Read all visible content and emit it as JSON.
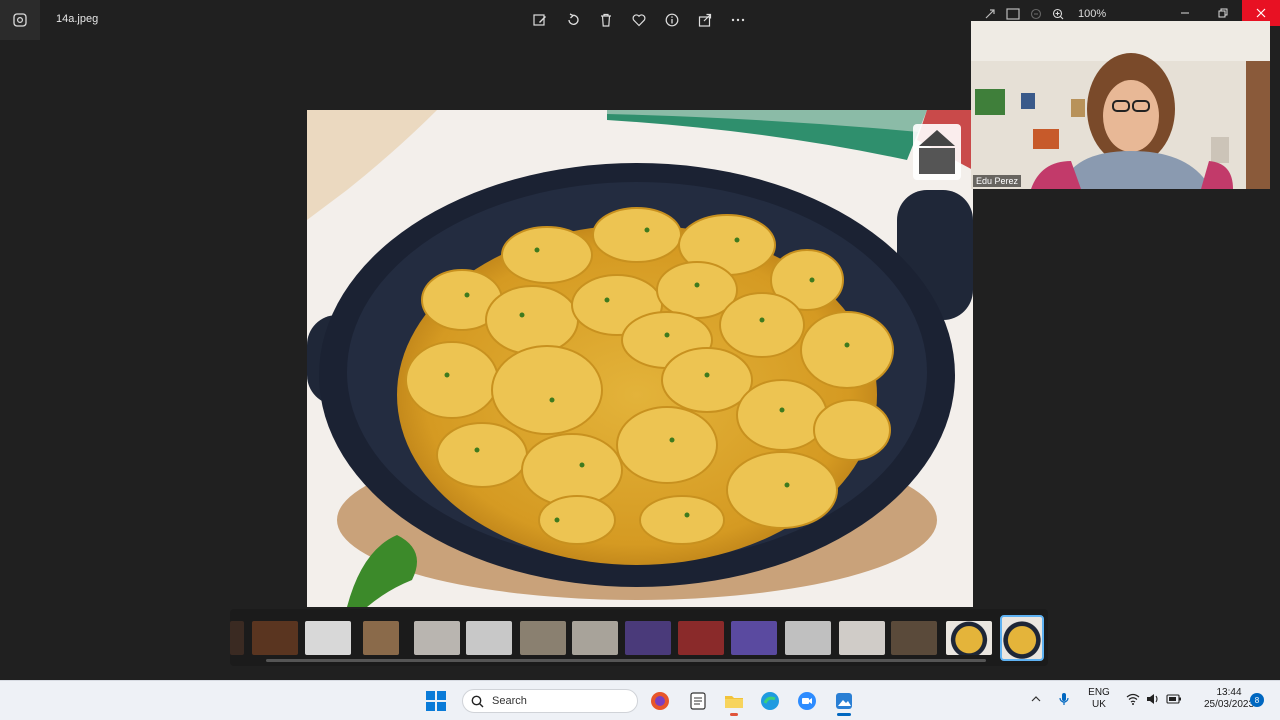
{
  "window": {
    "filename": "14a.jpeg",
    "zoom": "100%"
  },
  "toolbar": {
    "icons": [
      "edit-image-icon",
      "rotate-icon",
      "delete-icon",
      "favorite-icon",
      "info-icon",
      "share-icon",
      "more-icon"
    ]
  },
  "video_call": {
    "participant_name": "Edu Perez"
  },
  "filmstrip": {
    "thumb_count": 16,
    "selected_index": 15
  },
  "taskbar": {
    "search_label": "Search",
    "language_line1": "ENG",
    "language_line2": "UK",
    "time": "13:44",
    "date": "25/03/2023",
    "notification_count": "8"
  }
}
